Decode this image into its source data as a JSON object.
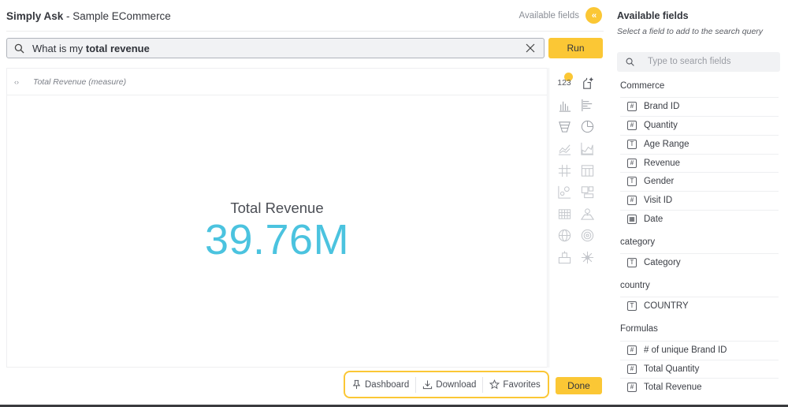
{
  "header": {
    "app_name": "Simply Ask",
    "separator": " - ",
    "dataset": "Sample ECommerce",
    "available_fields_label": "Available fields",
    "collapse_glyph": "‹‹"
  },
  "search": {
    "prefix": "What is my ",
    "highlighted": "total revenue",
    "icon": "search-icon"
  },
  "run_label": "Run",
  "result": {
    "code_glyph": "‹›",
    "label": "Total Revenue (measure)",
    "kpi_title": "Total Revenue",
    "kpi_value": "39.76M"
  },
  "viz_types": {
    "number_label": "123",
    "icons": [
      "number-icon",
      "ai-sparkle-icon",
      "column-chart-icon",
      "bar-chart-icon",
      "funnel-chart-icon",
      "pie-chart-icon",
      "line-chart-icon",
      "area-chart-icon",
      "grid-icon",
      "table-icon",
      "scatter-chart-icon",
      "combo-chart-icon",
      "heatmap-icon",
      "geo-map-icon",
      "globe-icon",
      "gauge-icon",
      "treemap-icon",
      "sunburst-icon"
    ]
  },
  "actions": {
    "dashboard": "Dashboard",
    "download": "Download",
    "favorites": "Favorites"
  },
  "done_label": "Done",
  "fields_panel": {
    "title": "Available fields",
    "subtitle": "Select a field to add to the search query",
    "search_placeholder": "Type to search fields",
    "groups": [
      {
        "name": "Commerce",
        "fields": [
          {
            "type": "#",
            "label": "Brand ID"
          },
          {
            "type": "#",
            "label": "Quantity"
          },
          {
            "type": "T",
            "label": "Age Range"
          },
          {
            "type": "#",
            "label": "Revenue"
          },
          {
            "type": "T",
            "label": "Gender"
          },
          {
            "type": "#",
            "label": "Visit ID"
          },
          {
            "type": "▦",
            "label": "Date"
          }
        ]
      },
      {
        "name": "category",
        "fields": [
          {
            "type": "T",
            "label": "Category"
          }
        ]
      },
      {
        "name": "country",
        "fields": [
          {
            "type": "T",
            "label": "COUNTRY"
          }
        ]
      },
      {
        "name": "Formulas",
        "fields": [
          {
            "type": "#",
            "label": "# of unique Brand ID"
          },
          {
            "type": "#",
            "label": "Total Quantity"
          },
          {
            "type": "#",
            "label": "Total Revenue"
          }
        ]
      }
    ]
  }
}
